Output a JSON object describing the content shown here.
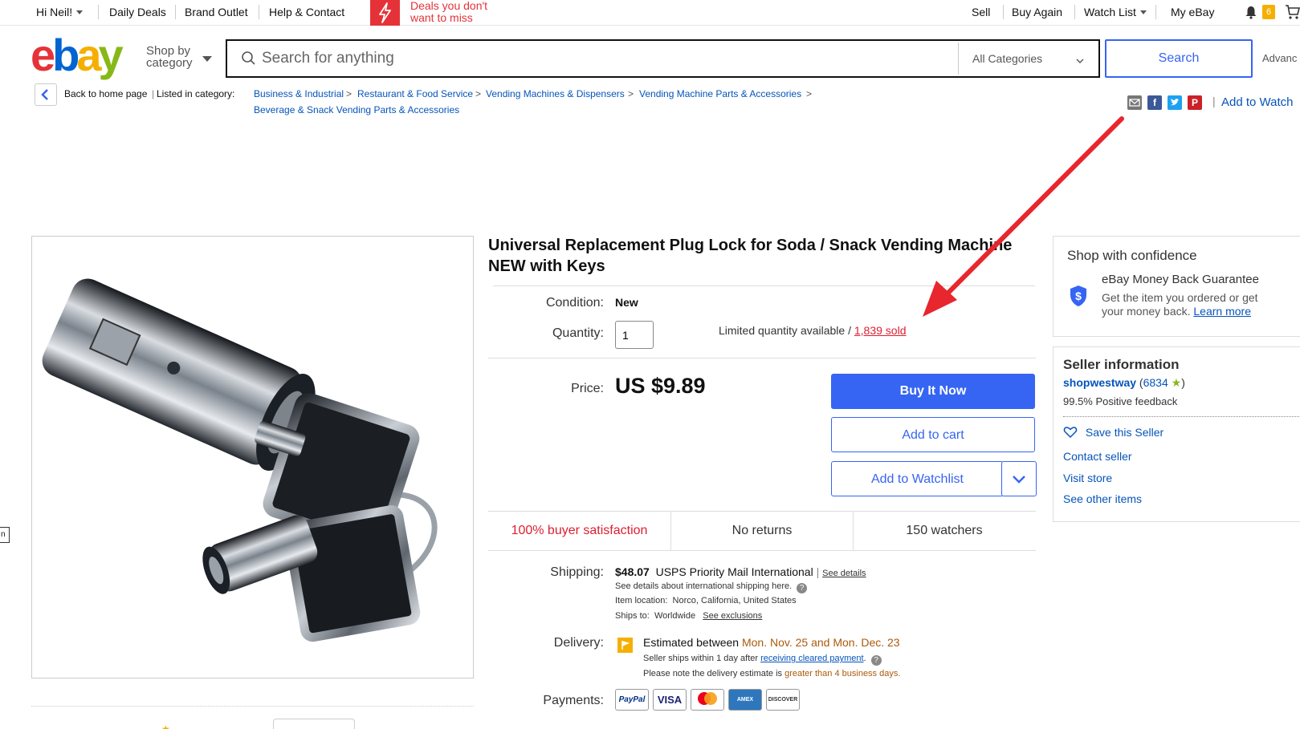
{
  "topbar": {
    "greeting": "Hi Neil!",
    "daily_deals": "Daily Deals",
    "brand_outlet": "Brand Outlet",
    "help_contact": "Help & Contact",
    "promo_text": "Deals you don't want to miss",
    "sell": "Sell",
    "buy_again": "Buy Again",
    "watch_list": "Watch List",
    "my_ebay": "My eBay",
    "notification_count": "6"
  },
  "header": {
    "shop_by_line1": "Shop by",
    "shop_by_line2": "category",
    "search_placeholder": "Search for anything",
    "category_selected": "All Categories",
    "search_button": "Search",
    "advanced": "Advanc"
  },
  "breadcrumb": {
    "back_label": "Back to home page",
    "listed_label": "Listed in category:",
    "items": [
      "Business & Industrial",
      "Restaurant & Food Service",
      "Vending Machines & Dispensers",
      "Vending Machine Parts & Accessories",
      "Beverage & Snack Vending Parts & Accessories"
    ],
    "separator": ">"
  },
  "share": {
    "add_to_watchlist": "Add to Watch"
  },
  "item": {
    "title": "Universal Replacement Plug Lock for Soda / Snack Vending Machine NEW with Keys",
    "condition_label": "Condition:",
    "condition_value": "New",
    "quantity_label": "Quantity:",
    "quantity_value": "1",
    "availability_text": "Limited quantity available / ",
    "sold_text": "1,839 sold",
    "price_label": "Price:",
    "price_value": "US $9.89",
    "buy_now": "Buy It Now",
    "add_to_cart": "Add to cart",
    "add_to_watchlist": "Add to Watchlist",
    "stat_satisfaction": "100% buyer satisfaction",
    "stat_returns": "No returns",
    "stat_watchers": "150 watchers",
    "shipping_label": "Shipping:",
    "shipping_price": "$48.07",
    "shipping_service": "USPS Priority Mail International",
    "see_details": "See details",
    "intl_shipping_note": "See details about international shipping here.",
    "item_location_label": "Item location:",
    "item_location": "Norco, California, United States",
    "ships_to_label": "Ships to:",
    "ships_to": "Worldwide",
    "see_exclusions": "See exclusions",
    "delivery_label": "Delivery:",
    "delivery_estimate_prefix": "Estimated between ",
    "delivery_dates": "Mon. Nov. 25 and Mon. Dec. 23",
    "seller_ships_prefix": "Seller ships within 1 day after ",
    "seller_ships_link": "receiving cleared payment",
    "delivery_note_prefix": "Please note the delivery estimate is ",
    "delivery_note_highlight": "greater than 4 business days.",
    "payments_label": "Payments:",
    "payment_methods": [
      "PayPal",
      "VISA",
      "Mastercard",
      "AMEX",
      "DISCOVER"
    ]
  },
  "confidence": {
    "title": "Shop with confidence",
    "guarantee_title": "eBay Money Back Guarantee",
    "guarantee_text": "Get the item you ordered or get",
    "guarantee_text2": "your money back.",
    "learn_more": "Learn more"
  },
  "seller": {
    "title": "Seller information",
    "name": "shopwestway",
    "feedback_count": "6834",
    "positive_feedback": "99.5% Positive feedback",
    "save_seller": "Save this Seller",
    "contact_seller": "Contact seller",
    "visit_store": "Visit store",
    "see_other_items": "See other items"
  },
  "colors": {
    "accent_blue": "#3665f3",
    "link_blue": "#0654ba",
    "ebay_red": "#e53238",
    "annotation_arrow": "#e8262d"
  },
  "edge_tab_text": "n"
}
